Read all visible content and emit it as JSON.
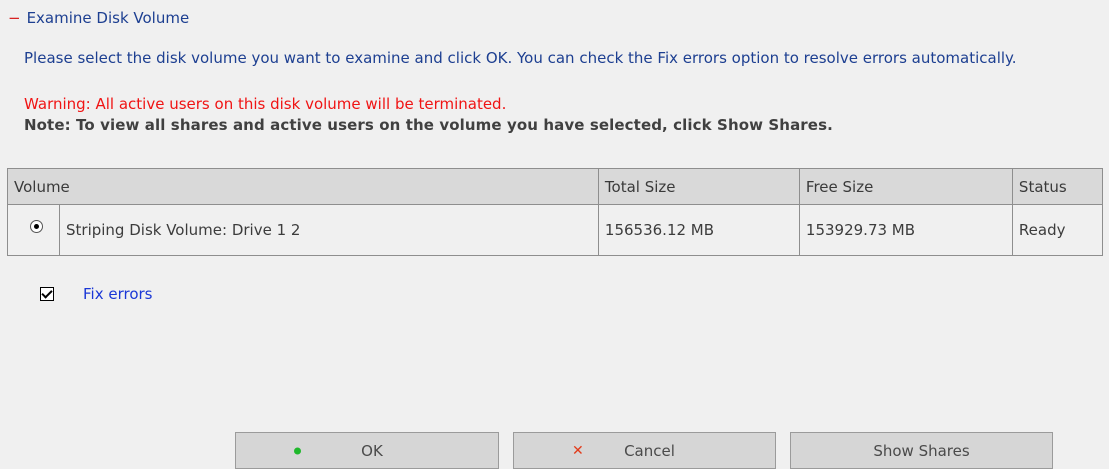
{
  "section": {
    "collapse_symbol": "−",
    "title": "Examine Disk Volume"
  },
  "description": "Please select the disk volume you want to examine and click OK. You can check the Fix errors option to resolve errors automatically.",
  "warning": "Warning: All active users on this disk volume will be terminated.",
  "note": "Note: To view all shares and active users on the volume you have selected, click Show Shares.",
  "table": {
    "headers": [
      "Volume",
      "Total Size",
      "Free Size",
      "Status"
    ],
    "rows": [
      {
        "selected": true,
        "volume": "Striping Disk Volume: Drive 1 2",
        "total_size": "156536.12 MB",
        "free_size": "153929.73 MB",
        "status": "Ready"
      }
    ]
  },
  "fix_errors": {
    "checked": true,
    "label": "Fix errors"
  },
  "buttons": {
    "ok": {
      "label": "OK",
      "icon": "green-dot-icon"
    },
    "cancel": {
      "label": "Cancel",
      "icon": "red-x-icon"
    },
    "show_shares": {
      "label": "Show Shares"
    }
  },
  "colors": {
    "title_blue": "#1d3f91",
    "warning_red": "#f01414",
    "link_blue": "#1a37d6",
    "header_bg": "#d9d9d9",
    "button_bg": "#d6d6d6"
  }
}
